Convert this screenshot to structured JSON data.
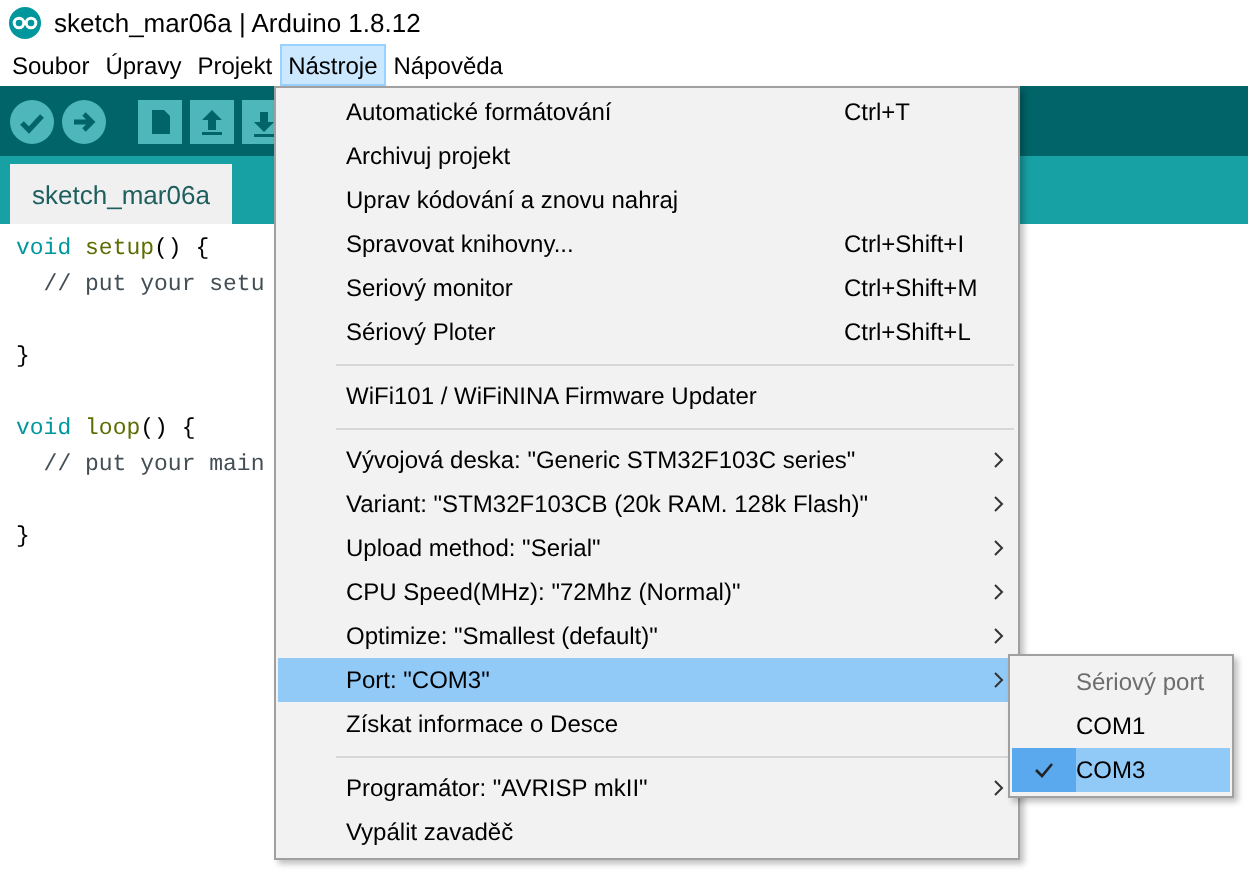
{
  "window": {
    "title": "sketch_mar06a | Arduino 1.8.12"
  },
  "menubar": [
    {
      "label": "Soubor",
      "selected": false
    },
    {
      "label": "Úpravy",
      "selected": false
    },
    {
      "label": "Projekt",
      "selected": false
    },
    {
      "label": "Nástroje",
      "selected": true
    },
    {
      "label": "Nápověda",
      "selected": false
    }
  ],
  "tabs": [
    {
      "label": "sketch_mar06a",
      "selected": true
    }
  ],
  "editor": {
    "blocks": [
      {
        "lines": [
          {
            "tokens": [
              {
                "kind": "keyword",
                "text": "void "
              },
              {
                "kind": "function",
                "text": "setup"
              },
              {
                "kind": "plain",
                "text": "() {"
              }
            ]
          },
          {
            "tokens": [
              {
                "kind": "comment",
                "text": "  // put your setu"
              }
            ]
          }
        ]
      },
      {
        "lines": [
          {
            "tokens": [
              {
                "kind": "plain",
                "text": "}"
              }
            ]
          }
        ]
      },
      {
        "lines": [
          {
            "tokens": [
              {
                "kind": "keyword",
                "text": "void "
              },
              {
                "kind": "function",
                "text": "loop"
              },
              {
                "kind": "plain",
                "text": "() {"
              }
            ]
          },
          {
            "tokens": [
              {
                "kind": "comment",
                "text": "  // put your main"
              }
            ]
          }
        ]
      },
      {
        "lines": [
          {
            "tokens": [
              {
                "kind": "plain",
                "text": "}"
              }
            ]
          }
        ]
      }
    ]
  },
  "menu": {
    "items": [
      {
        "kind": "item",
        "label": "Automatické formátování",
        "shortcut": "Ctrl+T",
        "selected": false
      },
      {
        "kind": "item",
        "label": "Archivuj projekt",
        "selected": false
      },
      {
        "kind": "item",
        "label": "Uprav kódování a znovu nahraj",
        "selected": false
      },
      {
        "kind": "item",
        "label": "Spravovat knihovny...",
        "shortcut": "Ctrl+Shift+I",
        "selected": false
      },
      {
        "kind": "item",
        "label": "Seriový monitor",
        "shortcut": "Ctrl+Shift+M",
        "selected": false
      },
      {
        "kind": "item",
        "label": "Sériový Ploter",
        "shortcut": "Ctrl+Shift+L",
        "selected": false
      },
      {
        "kind": "separator"
      },
      {
        "kind": "item",
        "label": "WiFi101 / WiFiNINA Firmware Updater",
        "selected": false
      },
      {
        "kind": "separator"
      },
      {
        "kind": "submenu",
        "label": "Vývojová deska: \"Generic STM32F103C series\"",
        "selected": false
      },
      {
        "kind": "submenu",
        "label": "Variant: \"STM32F103CB (20k RAM. 128k Flash)\"",
        "selected": false
      },
      {
        "kind": "submenu",
        "label": "Upload method: \"Serial\"",
        "selected": false
      },
      {
        "kind": "submenu",
        "label": "CPU Speed(MHz): \"72Mhz (Normal)\"",
        "selected": false
      },
      {
        "kind": "submenu",
        "label": "Optimize: \"Smallest (default)\"",
        "selected": false
      },
      {
        "kind": "submenu",
        "label": "Port: \"COM3\"",
        "selected": true
      },
      {
        "kind": "item",
        "label": "Získat informace o Desce",
        "selected": false
      },
      {
        "kind": "separator"
      },
      {
        "kind": "submenu",
        "label": "Programátor: \"AVRISP mkII\"",
        "selected": false
      },
      {
        "kind": "item",
        "label": "Vypálit zavaděč",
        "selected": false
      }
    ]
  },
  "submenu": {
    "header": "Sériový port",
    "items": [
      {
        "label": "COM1",
        "checked": false,
        "selected": false
      },
      {
        "label": "COM3",
        "checked": true,
        "selected": true
      }
    ]
  }
}
